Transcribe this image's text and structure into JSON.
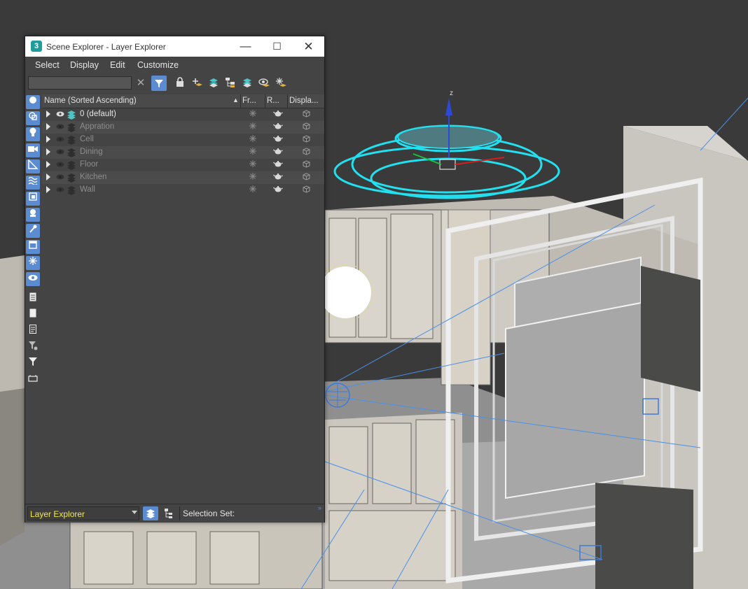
{
  "window": {
    "title": "Scene Explorer - Layer Explorer",
    "app_icon": "3",
    "minimize_glyph": "—",
    "maximize_glyph": "☐",
    "close_glyph": "✕"
  },
  "menu": [
    "Select",
    "Display",
    "Edit",
    "Customize"
  ],
  "search": {
    "value": "",
    "placeholder": ""
  },
  "toolbar_icons": [
    "clear-icon",
    "filter-toggle-icon",
    "lock-icon",
    "add-layer-icon",
    "layers-stack-icon",
    "hierarchy-icon",
    "layers-teal-icon",
    "eye-gear-icon",
    "snowflake-layers-icon"
  ],
  "leftbar_icons": [
    "circle-geometry-icon",
    "shapes-icon",
    "light-bulb-icon",
    "camera-icon",
    "helper-icon",
    "space-warp-icon",
    "group-icon",
    "xref-icon",
    "bone-icon",
    "container-icon",
    "frozen-icon",
    "eye-icon",
    "document-icon",
    "blank-document-icon",
    "list-document-icon",
    "filter-gear-icon",
    "filter-icon",
    "container-box-icon"
  ],
  "columns": {
    "name": "Name (Sorted Ascending)",
    "frozen": "Fr...",
    "render": "R...",
    "display": "Displa..."
  },
  "layers": [
    {
      "name": "0 (default)",
      "active": true
    },
    {
      "name": "Appration",
      "active": false
    },
    {
      "name": "Cell",
      "active": false
    },
    {
      "name": "Dining",
      "active": false
    },
    {
      "name": "Floor",
      "active": false
    },
    {
      "name": "Kitchen",
      "active": false
    },
    {
      "name": "Wall",
      "active": false
    }
  ],
  "bottom": {
    "explorer": "Layer Explorer",
    "selection_set": "Selection Set:"
  },
  "colors": {
    "accent": "#5b8bd0",
    "panel": "#444444",
    "highlight_layer": "#4ec4c4",
    "dropdown_text": "#f1e84a",
    "viewport_bg": "#3a3a3a",
    "chandelier": "#22e0f0"
  },
  "viewport": {
    "axis_label": "z"
  }
}
